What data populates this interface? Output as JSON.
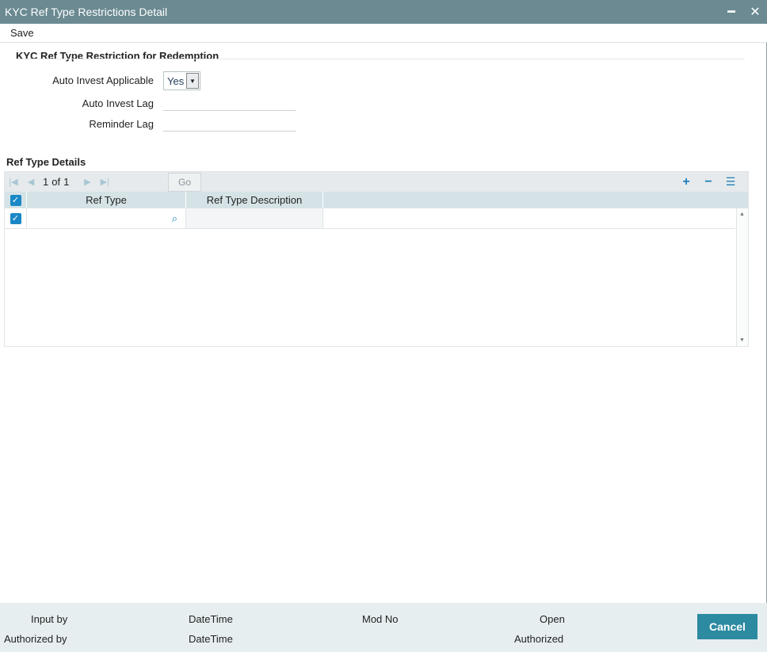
{
  "window": {
    "title": "KYC Ref Type Restrictions Detail",
    "minimize_glyph": "━",
    "close_glyph": "✕"
  },
  "menu": {
    "save_label": "Save"
  },
  "form": {
    "section_title": "KYC Ref Type Restriction for Redemption",
    "auto_invest_applicable_label": "Auto Invest Applicable",
    "auto_invest_applicable_value": "Yes",
    "auto_invest_lag_label": "Auto Invest Lag",
    "auto_invest_lag_value": "",
    "reminder_lag_label": "Reminder Lag",
    "reminder_lag_value": ""
  },
  "grid": {
    "title": "Ref Type Details",
    "pager": {
      "current": "1",
      "of_label": "of",
      "total": "1",
      "go_label": "Go"
    },
    "columns": [
      "Ref Type",
      "Ref Type Description"
    ],
    "rows": [
      {
        "checked": true,
        "ref_type": "",
        "ref_type_description": ""
      }
    ]
  },
  "footer": {
    "input_by_label": "Input by",
    "authorized_by_label": "Authorized by",
    "datetime_label_1": "DateTime",
    "datetime_label_2": "DateTime",
    "mod_no_label": "Mod No",
    "open_label": "Open",
    "authorized_label": "Authorized",
    "cancel_label": "Cancel"
  },
  "colors": {
    "titlebar": "#6b8a92",
    "accent": "#1a88c7",
    "cancel_button": "#2c8aa1",
    "footer_bg": "#e6eef0",
    "grid_header": "#d5e3e7"
  }
}
